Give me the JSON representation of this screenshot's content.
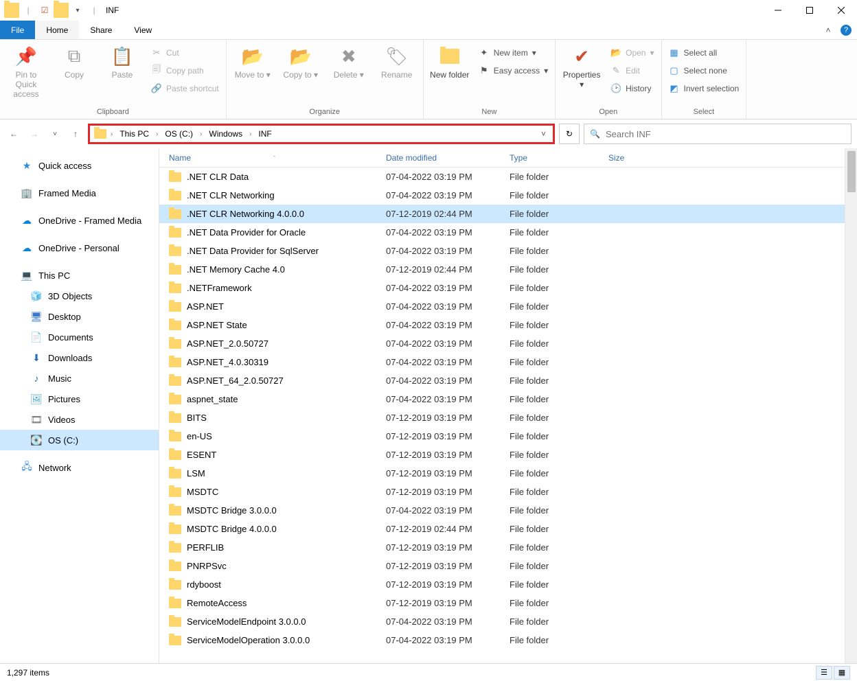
{
  "window": {
    "title": "INF"
  },
  "tabs": {
    "file": "File",
    "home": "Home",
    "share": "Share",
    "view": "View"
  },
  "ribbon": {
    "pin": "Pin to Quick access",
    "copy": "Copy",
    "paste": "Paste",
    "cut": "Cut",
    "copypath": "Copy path",
    "pasteshortcut": "Paste shortcut",
    "clipboard_label": "Clipboard",
    "moveto": "Move to",
    "copyto": "Copy to",
    "delete": "Delete",
    "rename": "Rename",
    "organize_label": "Organize",
    "newfolder": "New folder",
    "newitem": "New item",
    "easyaccess": "Easy access",
    "new_label": "New",
    "properties": "Properties",
    "open": "Open",
    "edit": "Edit",
    "history": "History",
    "open_label": "Open",
    "selectall": "Select all",
    "selectnone": "Select none",
    "invert": "Invert selection",
    "select_label": "Select"
  },
  "breadcrumb": [
    "This PC",
    "OS (C:)",
    "Windows",
    "INF"
  ],
  "search_placeholder": "Search INF",
  "navpane": {
    "quick": "Quick access",
    "framed": "Framed Media",
    "od_framed": "OneDrive - Framed Media",
    "od_personal": "OneDrive - Personal",
    "thispc": "This PC",
    "objects3d": "3D Objects",
    "desktop": "Desktop",
    "documents": "Documents",
    "downloads": "Downloads",
    "music": "Music",
    "pictures": "Pictures",
    "videos": "Videos",
    "osc": "OS (C:)",
    "network": "Network"
  },
  "columns": {
    "name": "Name",
    "date": "Date modified",
    "type": "Type",
    "size": "Size"
  },
  "rows": [
    {
      "name": ".NET CLR Data",
      "date": "07-04-2022 03:19 PM",
      "type": "File folder"
    },
    {
      "name": ".NET CLR Networking",
      "date": "07-04-2022 03:19 PM",
      "type": "File folder"
    },
    {
      "name": ".NET CLR Networking 4.0.0.0",
      "date": "07-12-2019 02:44 PM",
      "type": "File folder",
      "selected": true
    },
    {
      "name": ".NET Data Provider for Oracle",
      "date": "07-04-2022 03:19 PM",
      "type": "File folder"
    },
    {
      "name": ".NET Data Provider for SqlServer",
      "date": "07-04-2022 03:19 PM",
      "type": "File folder"
    },
    {
      "name": ".NET Memory Cache 4.0",
      "date": "07-12-2019 02:44 PM",
      "type": "File folder"
    },
    {
      "name": ".NETFramework",
      "date": "07-04-2022 03:19 PM",
      "type": "File folder"
    },
    {
      "name": "ASP.NET",
      "date": "07-04-2022 03:19 PM",
      "type": "File folder"
    },
    {
      "name": "ASP.NET State",
      "date": "07-04-2022 03:19 PM",
      "type": "File folder"
    },
    {
      "name": "ASP.NET_2.0.50727",
      "date": "07-04-2022 03:19 PM",
      "type": "File folder"
    },
    {
      "name": "ASP.NET_4.0.30319",
      "date": "07-04-2022 03:19 PM",
      "type": "File folder"
    },
    {
      "name": "ASP.NET_64_2.0.50727",
      "date": "07-04-2022 03:19 PM",
      "type": "File folder"
    },
    {
      "name": "aspnet_state",
      "date": "07-04-2022 03:19 PM",
      "type": "File folder"
    },
    {
      "name": "BITS",
      "date": "07-12-2019 03:19 PM",
      "type": "File folder"
    },
    {
      "name": "en-US",
      "date": "07-12-2019 03:19 PM",
      "type": "File folder"
    },
    {
      "name": "ESENT",
      "date": "07-12-2019 03:19 PM",
      "type": "File folder"
    },
    {
      "name": "LSM",
      "date": "07-12-2019 03:19 PM",
      "type": "File folder"
    },
    {
      "name": "MSDTC",
      "date": "07-12-2019 03:19 PM",
      "type": "File folder"
    },
    {
      "name": "MSDTC Bridge 3.0.0.0",
      "date": "07-04-2022 03:19 PM",
      "type": "File folder"
    },
    {
      "name": "MSDTC Bridge 4.0.0.0",
      "date": "07-12-2019 02:44 PM",
      "type": "File folder"
    },
    {
      "name": "PERFLIB",
      "date": "07-12-2019 03:19 PM",
      "type": "File folder"
    },
    {
      "name": "PNRPSvc",
      "date": "07-12-2019 03:19 PM",
      "type": "File folder"
    },
    {
      "name": "rdyboost",
      "date": "07-12-2019 03:19 PM",
      "type": "File folder"
    },
    {
      "name": "RemoteAccess",
      "date": "07-12-2019 03:19 PM",
      "type": "File folder"
    },
    {
      "name": "ServiceModelEndpoint 3.0.0.0",
      "date": "07-04-2022 03:19 PM",
      "type": "File folder"
    },
    {
      "name": "ServiceModelOperation 3.0.0.0",
      "date": "07-04-2022 03:19 PM",
      "type": "File folder"
    }
  ],
  "status": {
    "items": "1,297 items"
  }
}
